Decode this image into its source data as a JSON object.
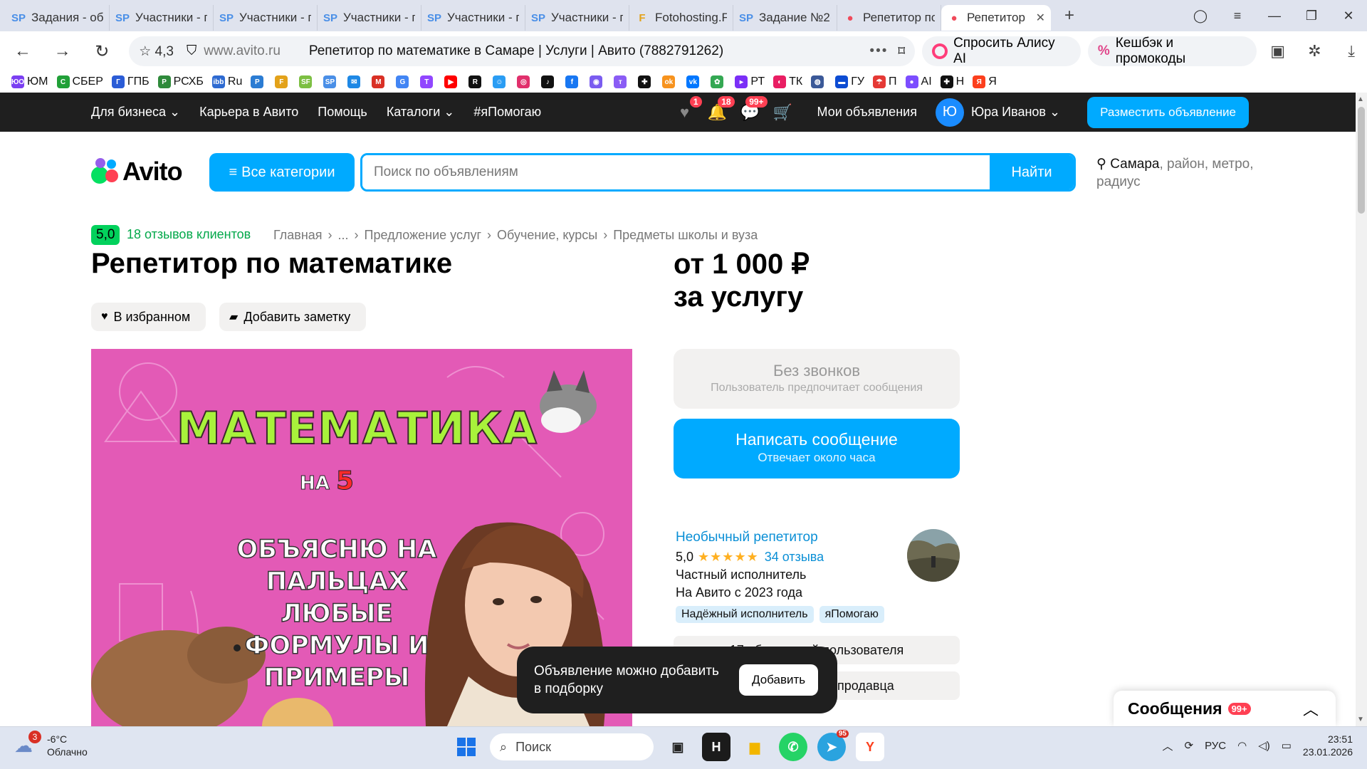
{
  "browser": {
    "tabs": [
      {
        "icon": "SP",
        "label": "Задания - об",
        "color": "#4a8fe7"
      },
      {
        "icon": "SP",
        "label": "Участники - г",
        "color": "#4a8fe7"
      },
      {
        "icon": "SP",
        "label": "Участники - г",
        "color": "#4a8fe7"
      },
      {
        "icon": "SP",
        "label": "Участники - г",
        "color": "#4a8fe7"
      },
      {
        "icon": "SP",
        "label": "Участники - г",
        "color": "#4a8fe7"
      },
      {
        "icon": "SP",
        "label": "Участники - г",
        "color": "#4a8fe7"
      },
      {
        "icon": "F",
        "label": "Fotohosting.F",
        "color": "#e3a21a"
      },
      {
        "icon": "SP",
        "label": "Задание №2(",
        "color": "#4a8fe7"
      },
      {
        "icon": "●",
        "label": "Репетитор по",
        "color": "#f04a5a"
      }
    ],
    "active_tab": {
      "icon": "●",
      "label": "Репетитор",
      "color": "#f04a5a"
    },
    "address": {
      "rating": "4,3",
      "domain": "www.avito.ru",
      "page_title": "Репетитор по математике в Самаре | Услуги | Авито (7882791262)"
    },
    "alice_label": "Спросить Алису AI",
    "cashback_label": "Кешбэк и промокоды",
    "bookmarks": [
      {
        "icon": "ЮО",
        "label": "ЮМ",
        "color": "#7b3ff2"
      },
      {
        "icon": "С",
        "label": "СБЕР",
        "color": "#21a038"
      },
      {
        "icon": "Г",
        "label": "ГПБ",
        "color": "#2b5cd6"
      },
      {
        "icon": "Р",
        "label": "РСХБ",
        "color": "#2f8a3b"
      },
      {
        "icon": "ibb",
        "label": "Ru",
        "color": "#2e6ad1"
      },
      {
        "icon": "P",
        "label": "",
        "color": "#2b7cd3"
      },
      {
        "icon": "F",
        "label": "",
        "color": "#e3a21a"
      },
      {
        "icon": "SF",
        "label": "",
        "color": "#7cbf42"
      },
      {
        "icon": "SP",
        "label": "",
        "color": "#4a8fe7"
      },
      {
        "icon": "✉",
        "label": "",
        "color": "#1e88e5"
      },
      {
        "icon": "M",
        "label": "",
        "color": "#d93025"
      },
      {
        "icon": "G",
        "label": "",
        "color": "#4285f4"
      },
      {
        "icon": "T",
        "label": "",
        "color": "#9146ff"
      },
      {
        "icon": "▶",
        "label": "",
        "color": "#ff0000"
      },
      {
        "icon": "R",
        "label": "",
        "color": "#111111"
      },
      {
        "icon": "☺",
        "label": "",
        "color": "#2a9df4"
      },
      {
        "icon": "◎",
        "label": "",
        "color": "#e1306c"
      },
      {
        "icon": "♪",
        "label": "",
        "color": "#111111"
      },
      {
        "icon": "f",
        "label": "",
        "color": "#1877f2"
      },
      {
        "icon": "◉",
        "label": "",
        "color": "#7a5cf0"
      },
      {
        "icon": "т",
        "label": "",
        "color": "#8a5cf5"
      },
      {
        "icon": "✚",
        "label": "",
        "color": "#111111"
      },
      {
        "icon": "ok",
        "label": "",
        "color": "#f7931e"
      },
      {
        "icon": "vk",
        "label": "",
        "color": "#0077ff"
      },
      {
        "icon": "✿",
        "label": "",
        "color": "#34a853"
      },
      {
        "icon": "▸",
        "label": "РТ",
        "color": "#7b2ff7"
      },
      {
        "icon": "◐",
        "label": "ТК",
        "color": "#e91e63"
      },
      {
        "icon": "◍",
        "label": "",
        "color": "#3b5998"
      },
      {
        "icon": "▬",
        "label": "ГУ",
        "color": "#0d4cd3"
      },
      {
        "icon": "☂",
        "label": "П",
        "color": "#e53935"
      },
      {
        "icon": "●",
        "label": "AI",
        "color": "#7c4dff"
      },
      {
        "icon": "✚",
        "label": "Н",
        "color": "#111111"
      },
      {
        "icon": "Я",
        "label": "Я",
        "color": "#fc3f1d"
      }
    ]
  },
  "avito_topbar": {
    "nav": [
      "Для бизнеса ⌄",
      "Карьера в Авито",
      "Помощь",
      "Каталоги ⌄",
      "#яПомогаю"
    ],
    "favorites_badge": "1",
    "notifications_badge": "18",
    "messages_badge": "99+",
    "my_ads": "Мои объявления",
    "user_initial": "Ю",
    "user_name": "Юра Иванов ⌄",
    "place_ad": "Разместить объявление"
  },
  "header": {
    "logo_text": "Avito",
    "categories_btn": "Все категории",
    "search_placeholder": "Поиск по объявлениям",
    "search_btn": "Найти",
    "location_city": "Самара",
    "location_rest": ", район, метро, радиус"
  },
  "listing": {
    "rating": "5,0",
    "reviews_link": "18 отзывов клиентов",
    "breadcrumbs": [
      "Главная",
      "›",
      "...",
      "›",
      "Предложение услуг",
      "›",
      "Обучение, курсы",
      "›",
      "Предметы школы и вуза"
    ],
    "title": "Репетитор по математике",
    "price_line1": "от 1 000 ₽",
    "price_line2": "за услугу",
    "favorite_btn": "В избранном",
    "note_btn": "Добавить заметку",
    "image_text": {
      "headline": "МАТЕМАТИКА",
      "na": "НА",
      "grade": "5",
      "body": "ОБЪЯСНЮ НА ПАЛЬЦАХ ЛЮБЫЕ ФОРМУЛЫ И ПРИМЕРЫ"
    }
  },
  "contact": {
    "no_calls_title": "Без звонков",
    "no_calls_sub": "Пользователь предпочитает сообщения",
    "write_title": "Написать сообщение",
    "write_sub": "Отвечает около часа"
  },
  "seller": {
    "name": "Необычный репетитор",
    "rating": "5,0",
    "stars": "★★★★★",
    "reviews": "34 отзыва",
    "type": "Частный исполнитель",
    "since": "На Авито с 2023 года",
    "tags": [
      "Надёжный исполнитель",
      "яПомогаю"
    ],
    "subscribers": "17 объявлений пользователя",
    "subscribe_seller": "Подписаться на продавца"
  },
  "toast": {
    "text": "Объявление можно добавить в подборку",
    "button": "Добавить"
  },
  "messages_widget": {
    "title": "Сообщения",
    "badge": "99+"
  },
  "taskbar": {
    "weather_badge": "3",
    "temp": "-6°C",
    "condition": "Облачно",
    "search_placeholder": "Поиск",
    "telegram_badge": "95",
    "lang": "РУС",
    "time": "23:51",
    "date": "23.01.2026"
  }
}
